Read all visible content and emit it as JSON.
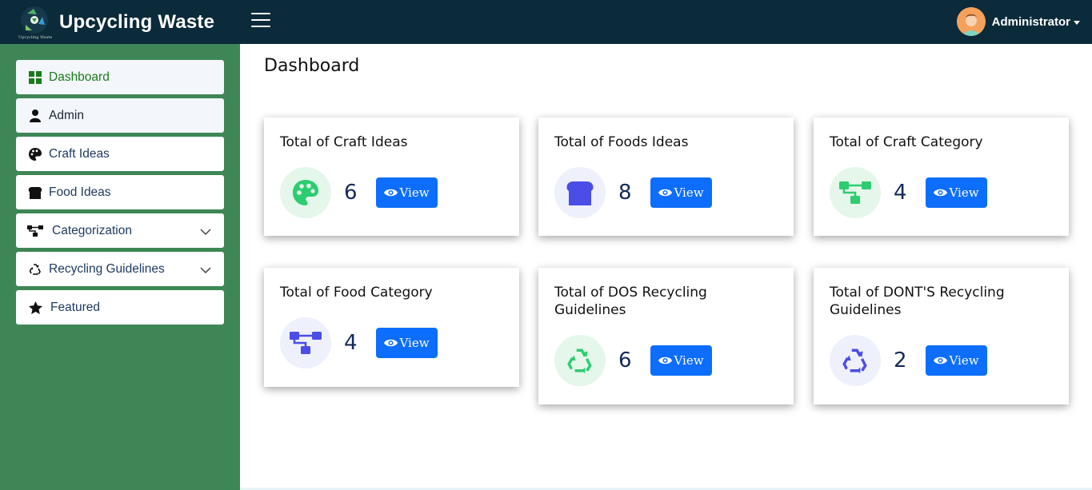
{
  "header": {
    "brand_name": "Upcycling Waste",
    "logo_caption": "Upcycling Waste",
    "user_name": "Administrator"
  },
  "sidebar": {
    "items": [
      {
        "label": "Dashboard",
        "icon": "grid-icon"
      },
      {
        "label": "Admin",
        "icon": "user-icon"
      },
      {
        "label": "Craft Ideas",
        "icon": "palette-icon"
      },
      {
        "label": "Food Ideas",
        "icon": "bread-icon"
      },
      {
        "label": "Categorization",
        "icon": "sitemap-icon"
      },
      {
        "label": "Recycling Guidelines",
        "icon": "recycle-icon"
      },
      {
        "label": "Featured",
        "icon": "star-icon"
      }
    ]
  },
  "main": {
    "title": "Dashboard",
    "view_label": "View",
    "cards": [
      {
        "title": "Total of Craft Ideas",
        "count": "6",
        "icon": "palette-icon",
        "accent": "#2ecc71"
      },
      {
        "title": "Total of Foods Ideas",
        "count": "8",
        "icon": "bread-icon",
        "accent": "#4a4de6"
      },
      {
        "title": "Total of Craft Category",
        "count": "4",
        "icon": "sitemap-icon",
        "accent": "#2ecc71"
      },
      {
        "title": "Total of Food Category",
        "count": "4",
        "icon": "sitemap-icon",
        "accent": "#4a4de6"
      },
      {
        "title": "Total of DOS Recycling Guidelines",
        "count": "6",
        "icon": "recycle-icon",
        "accent": "#2ecc71"
      },
      {
        "title": "Total of DONT'S Recycling Guidelines",
        "count": "2",
        "icon": "recycle-icon",
        "accent": "#4a4de6"
      }
    ]
  },
  "colors": {
    "topbar": "#0b2a3a",
    "sidebar": "#3e8656",
    "button": "#0d6efd",
    "count_text": "#122a5c"
  }
}
